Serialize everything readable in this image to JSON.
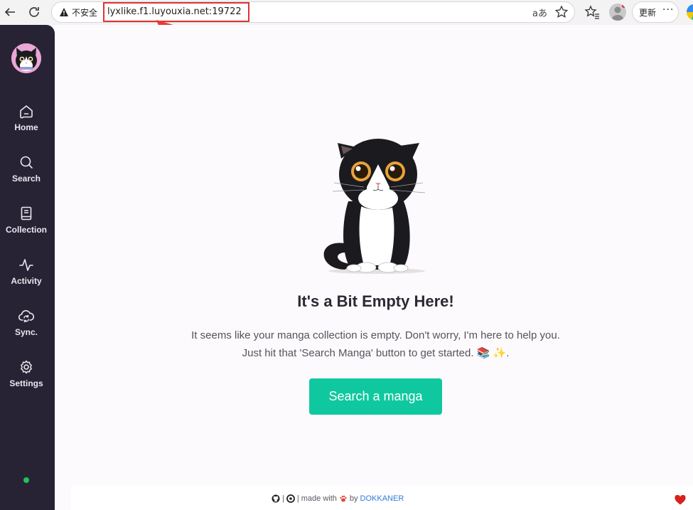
{
  "browser": {
    "insecure_label": "不安全",
    "url": "lyxlike.f1.luyouxia.net:19722",
    "translate_glyph": "aあ",
    "update_label": "更新",
    "more_label": "···",
    "accent_red": "#e03434"
  },
  "sidebar": {
    "items": [
      {
        "label": "Home",
        "icon": "home-icon"
      },
      {
        "label": "Search",
        "icon": "search-icon"
      },
      {
        "label": "Collection",
        "icon": "book-icon"
      },
      {
        "label": "Activity",
        "icon": "activity-icon"
      },
      {
        "label": "Sync.",
        "icon": "cloud-sync-icon"
      },
      {
        "label": "Settings",
        "icon": "gear-icon"
      }
    ],
    "background": "#272335",
    "status_color": "#1ec35a"
  },
  "main": {
    "title": "It's a Bit Empty Here!",
    "message_line1": "It seems like your manga collection is empty. Don't worry, I'm here to help you.",
    "message_line2": "Just hit that 'Search Manga' button to get started. 📚 ✨.",
    "button_label": "Search a manga",
    "button_color": "#10c8a0"
  },
  "footer": {
    "separator": "|",
    "made_with": "| made with",
    "by": "by",
    "author": "DOKKANER"
  }
}
